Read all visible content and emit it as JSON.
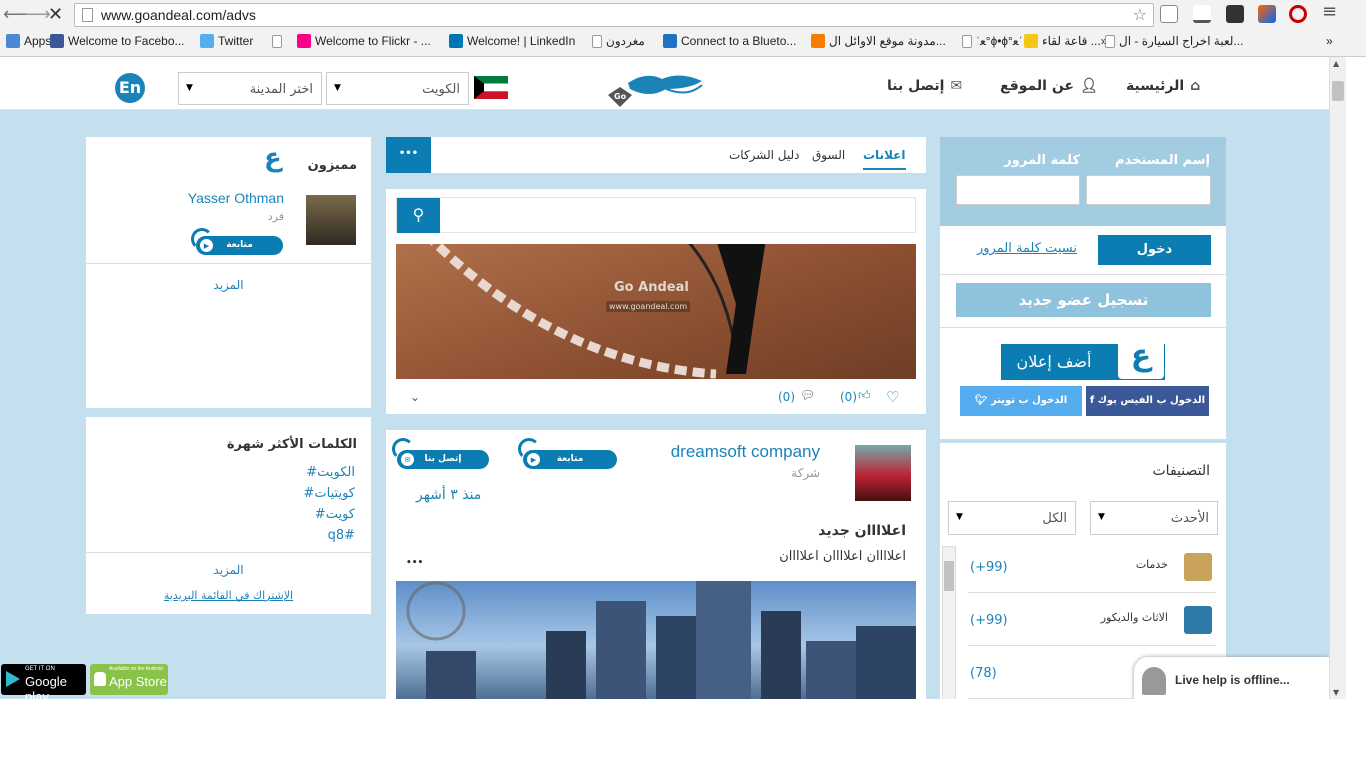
{
  "browser": {
    "url": "www.goandeal.com/advs",
    "bookmarks": [
      {
        "label": "Apps",
        "color": "#4a88d6"
      },
      {
        "label": "Welcome to Facebo...",
        "color": "#3b5998"
      },
      {
        "label": "Twitter",
        "color": "#55acee"
      },
      {
        "label": "",
        "color": "#ffffff"
      },
      {
        "label": "Welcome to Flickr - ...",
        "color": "#ff0084"
      },
      {
        "label": "Welcome! | LinkedIn",
        "color": "#0077b5"
      },
      {
        "label": "مغردون",
        "color": "#ffffff"
      },
      {
        "label": "Connect to a Blueto...",
        "color": "#1e74c2"
      },
      {
        "label": "مدونة موقع الاوائل ال...",
        "color": "#f57d00"
      },
      {
        "label": "ʿﻌ°ɸ•ɸ°ﻌʿ",
        "color": "#ffffff"
      },
      {
        "label": "قاعة لقاء ...»»",
        "color": "#f5c518"
      },
      {
        "label": "لعبة اخراج السيارة - ال...",
        "color": "#ffffff"
      }
    ],
    "more": "»"
  },
  "header": {
    "nav": {
      "home": "الرئيسية",
      "about": "عن الموقع",
      "contact": "إتصل بنا"
    },
    "country_select": "الكويت",
    "city_select": "اختر المدينة",
    "lang": "En"
  },
  "featured": {
    "title": "مميزون",
    "user_name": "Yasser Othman",
    "user_type": "فرد",
    "follow": "متابعة",
    "more": "المزيد"
  },
  "keywords": {
    "title": "الكلمات الأكثر شهرة",
    "items": [
      "#الكويت",
      "#كويتيات",
      "#كويت",
      "q8#"
    ],
    "more": "المزيد",
    "subscribe": "الإشتراك في القائمة البريدية"
  },
  "stores": {
    "google": "Google play",
    "google_top": "GET IT ON",
    "apple": "App Store",
    "apple_top": "Available on the Android"
  },
  "tabs": {
    "ads": "اعلانات",
    "market": "السوق",
    "directory": "دليل الشركات",
    "more": "•••"
  },
  "post1": {
    "watermark": "Go Andeal",
    "watermark_url": "www.goandeal.com",
    "likes": "(0)",
    "comments": "(0)"
  },
  "post2": {
    "company": "dreamsoft company",
    "type": "شركة",
    "follow": "متابعة",
    "contact": "إتصل بنا",
    "time": "منذ ٣ أشهر",
    "title": "اعلاااان جديد",
    "body": "اعلاااان اعلاااان اعلاااان",
    "more": "•••"
  },
  "login": {
    "username_label": "إسم المستخدم",
    "password_label": "كلمة المرور",
    "login_btn": "دخول",
    "forgot": "نسيت كلمة المرور",
    "register": "تسجيل عضو جديد",
    "add_ad": "أضف إعلان",
    "fb_login": "الدخول ب الفيس بوك",
    "tw_login": "الدخول ب تويتر"
  },
  "categories": {
    "title": "التصنيفات",
    "sort": "الأحدث",
    "filter": "الكل",
    "items": [
      {
        "name": "خدمات",
        "count": "(+99)"
      },
      {
        "name": "الاثاث والديكور",
        "count": "(+99)"
      },
      {
        "name": "",
        "count": "(78)"
      }
    ]
  },
  "livehelp": "Live help is offline..."
}
